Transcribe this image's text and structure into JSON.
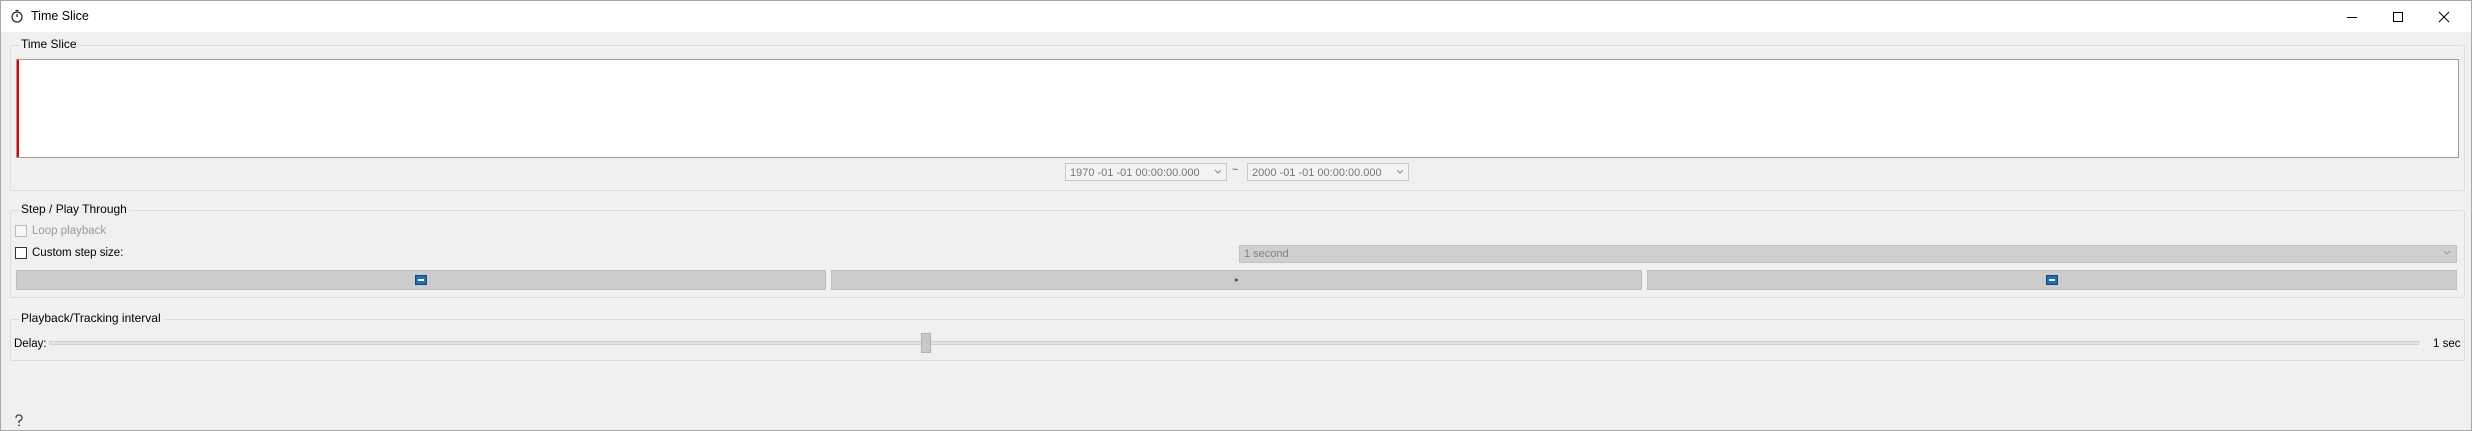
{
  "window": {
    "title": "Time Slice",
    "controls": [
      "minimize-icon",
      "maximize-icon",
      "close-icon"
    ]
  },
  "time_slice": {
    "group_title": "Time Slice",
    "start": "1970 -01 -01   00:00:00.000",
    "separator": "~",
    "end": "2000 -01 -01   00:00:00.000",
    "cursor_color": "#e00000"
  },
  "step": {
    "group_title": "Step / Play Through",
    "loop_label": "Loop playback",
    "custom_step_label": "Custom step size:",
    "step_value": "1 second",
    "buttons": [
      "step-back-icon",
      "play-icon",
      "step-forward-icon"
    ],
    "accent": "#1f6fb2"
  },
  "playback": {
    "group_title": "Playback/Tracking interval",
    "delay_label": "Delay:",
    "delay_value": "1 sec",
    "delay_fraction": 0.37
  }
}
